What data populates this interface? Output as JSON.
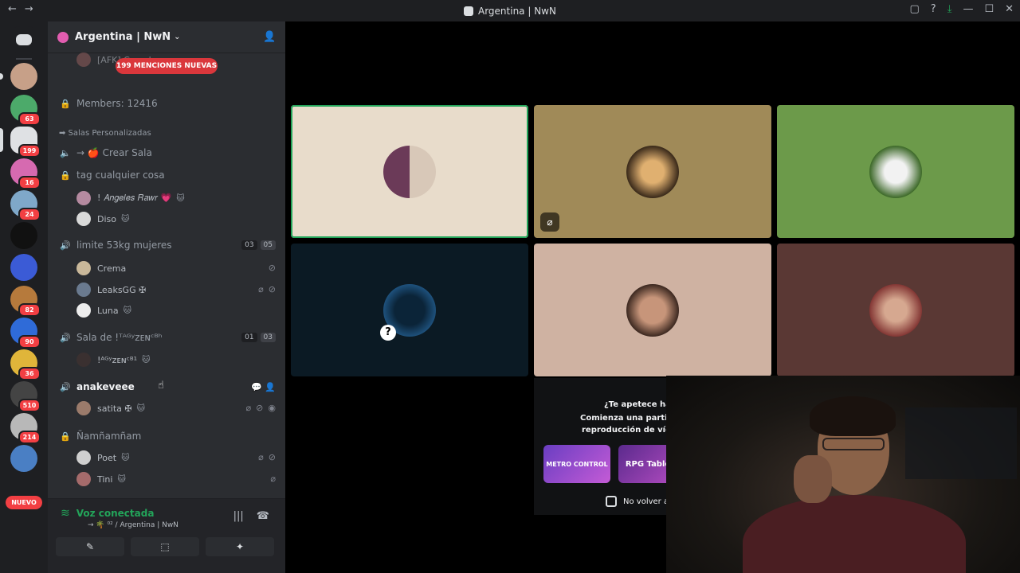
{
  "window": {
    "title": "Argentina | NwN",
    "back": "←",
    "forward": "→",
    "controls": [
      "▢",
      "?",
      "⤓",
      "—",
      "☐",
      "✕"
    ]
  },
  "servers": {
    "badges": [
      "63",
      "199",
      "16",
      "24",
      "82",
      "90",
      "36",
      "510",
      "214"
    ],
    "new_label": "NUEVO"
  },
  "guild": {
    "name": "Argentina | NwN",
    "mentions_pill": "199 MENCIONES NUEVAS",
    "partial_user": "[AFK] Carcelas",
    "members_channel": "Members: 12416",
    "category": "➡ Salas Personalizadas",
    "channels": [
      {
        "label": "→ 🍎 Crear Sala"
      },
      {
        "label": "tag cualquier cosa"
      },
      {
        "label": "limite 53kg mujeres",
        "counts": [
          "03",
          "05"
        ]
      },
      {
        "label": "Sala de !ᵀᴬᴳʸᴢᴇɴᶜᴮʰ",
        "counts": [
          "01",
          "03"
        ]
      },
      {
        "label": "anakeveee"
      },
      {
        "label": "Ñamñamñam"
      }
    ],
    "users": {
      "angeles": "! 𝐴𝑛𝑔𝑒𝑙𝑒𝑠 𝑅𝑎𝑤𝑟 💗",
      "diso": "Diso",
      "crema": "Crema",
      "leaks": "LeaksGG ✠",
      "luna": "Luna",
      "yzen": "!ᴬᴳʸᴢᴇɴᶜᴮ¹",
      "satita": "satita ✠",
      "poet": "Poet",
      "tini": "Tini"
    }
  },
  "voice": {
    "status": "Voz conectada",
    "channel": "→ 🌴 ⁰² / Argentina | NwN",
    "buttons": [
      "✎",
      "⬚",
      "✦"
    ]
  },
  "promo": {
    "line1": "¿Te apetece hac",
    "line2": "Comienza una partida",
    "line3": "reproducción de víde",
    "card1": "METRO CONTROL",
    "card2": "RPG Table",
    "checkbox": "No volver a"
  },
  "colors": {
    "green": "#23a55a",
    "red": "#f23f43",
    "sidebar": "#2b2d31",
    "rail": "#1e1f22"
  }
}
